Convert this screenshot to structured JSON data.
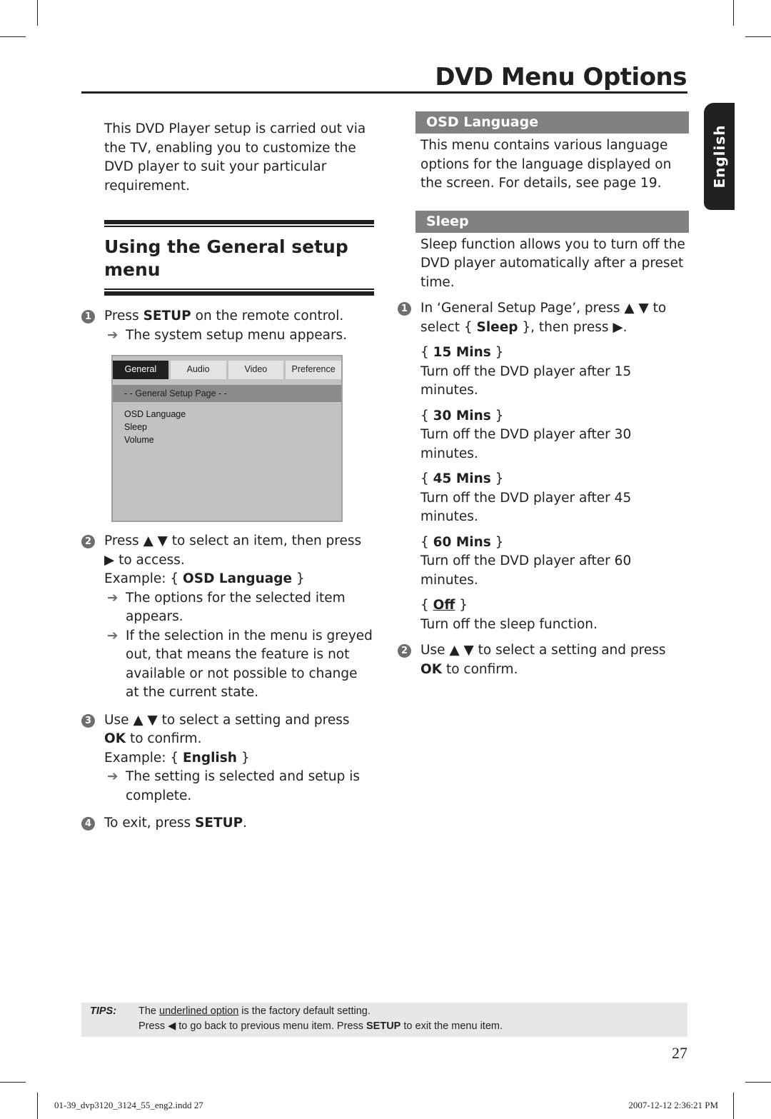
{
  "header": {
    "title": "DVD Menu Options"
  },
  "side_tab": {
    "label": "English"
  },
  "left": {
    "intro": "This DVD Player setup is carried out via the TV, enabling you to customize the DVD player to suit your particular requirement.",
    "section_title": "Using the General setup menu",
    "step1": {
      "num": "1",
      "pre": "Press ",
      "key": "SETUP",
      "post": " on the remote control.",
      "result": "The system setup menu appears."
    },
    "menu_screenshot": {
      "tabs": [
        "General",
        "Audio",
        "Video",
        "Preference"
      ],
      "active_tab": "General",
      "page_title": "- -  General Setup Page  - -",
      "items": [
        "OSD Language",
        "Sleep",
        "Volume"
      ]
    },
    "step2": {
      "num": "2",
      "line1": "Press ▲ ▼ to select an item, then press ▶ to access.",
      "example_pre": "Example: { ",
      "example_key": "OSD Language",
      "example_post": " }",
      "result1": "The options for the selected item appears.",
      "result2": "If the selection in the menu is greyed out, that means the feature is not available or not possible to change at the current state."
    },
    "step3": {
      "num": "3",
      "pre": "Use ▲ ▼ to select a setting and press ",
      "key": "OK",
      "post": " to confirm.",
      "example_pre": "Example: { ",
      "example_key": "English",
      "example_post": " }",
      "result": "The setting is selected and setup is complete."
    },
    "step4": {
      "num": "4",
      "pre": "To exit, press ",
      "key": "SETUP",
      "post": "."
    }
  },
  "right": {
    "osd_heading": "OSD Language",
    "osd_text": "This menu contains various language options for the language displayed on the screen. For details, see page 19.",
    "sleep_heading": "Sleep",
    "sleep_text": "Sleep function allows you to turn off the DVD player automatically after a preset time.",
    "step1": {
      "num": "1",
      "pre": "In ‘General Setup Page’, press ▲ ▼ to select { ",
      "key": "Sleep",
      "post": " }, then press ▶."
    },
    "options": [
      {
        "label": "15 Mins",
        "desc": "Turn off the DVD player after 15 minutes.",
        "default": false
      },
      {
        "label": "30 Mins",
        "desc": "Turn off the DVD player after 30 minutes.",
        "default": false
      },
      {
        "label": "45 Mins",
        "desc": "Turn off the DVD player after 45 minutes.",
        "default": false
      },
      {
        "label": "60 Mins",
        "desc": "Turn off the DVD player after 60 minutes.",
        "default": false
      },
      {
        "label": "Off",
        "desc": "Turn off the sleep function.",
        "default": true
      }
    ],
    "step2": {
      "num": "2",
      "pre": "Use ▲ ▼ to select a setting and press ",
      "key": "OK",
      "post": " to confirm."
    }
  },
  "tips": {
    "label": "TIPS:",
    "line1_pre": "The ",
    "line1_u": "underlined option",
    "line1_post": " is the factory default setting.",
    "line2_pre": "Press ◀ to go back to previous menu item. Press ",
    "line2_key": "SETUP",
    "line2_post": " to exit the menu item."
  },
  "footer": {
    "page_number": "27",
    "slug_file": "01-39_dvp3120_3124_55_eng2.indd   27",
    "slug_date": "2007-12-12   2:36:21 PM"
  }
}
